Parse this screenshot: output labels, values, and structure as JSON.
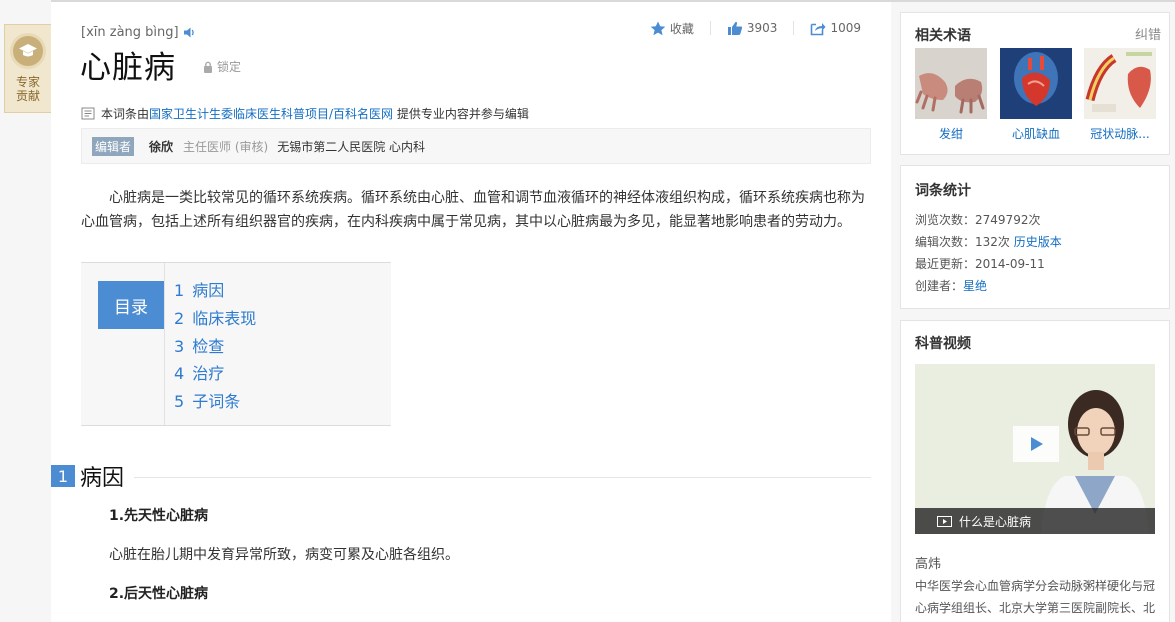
{
  "expert_badge": {
    "label": "专家贡献"
  },
  "entry": {
    "pinyin": "[xīn zàng bìng]",
    "title": "心脏病",
    "lock_label": "锁定"
  },
  "actions": {
    "favorite_label": "收藏",
    "like_count": "3903",
    "share_count": "1009"
  },
  "provider": {
    "prefix": "本词条由",
    "org_link": "国家卫生计生委临床医生科普项目/百科名医网",
    "suffix": "提供专业内容并参与编辑"
  },
  "editor": {
    "tag": "编辑者",
    "name": "徐欣",
    "role": "主任医师 (审核)",
    "organization": "无锡市第二人民医院 心内科"
  },
  "intro": "心脏病是一类比较常见的循环系统疾病。循环系统由心脏、血管和调节血液循环的神经体液组织构成，循环系统疾病也称为心血管病，包括上述所有组织器官的疾病，在内科疾病中属于常见病，其中以心脏病最为多见，能显著地影响患者的劳动力。",
  "toc": {
    "label": "目录",
    "items": [
      {
        "num": "1",
        "text": "病因"
      },
      {
        "num": "2",
        "text": "临床表现"
      },
      {
        "num": "3",
        "text": "检查"
      },
      {
        "num": "4",
        "text": "治疗"
      },
      {
        "num": "5",
        "text": "子词条"
      }
    ]
  },
  "section1": {
    "num": "1",
    "title": "病因",
    "sub1": "1.先天性心脏病",
    "para1": "心脏在胎儿期中发育异常所致，病变可累及心脏各组织。",
    "sub2": "2.后天性心脏病"
  },
  "related": {
    "title": "相关术语",
    "correction": "纠错",
    "terms": [
      {
        "label": "发绀"
      },
      {
        "label": "心肌缺血"
      },
      {
        "label": "冠状动脉..."
      }
    ]
  },
  "stats": {
    "title": "词条统计",
    "views_label": "浏览次数：",
    "views": "2749792次",
    "edits_label": "编辑次数：",
    "edits": "132次",
    "history_link": "历史版本",
    "updated_label": "最近更新：",
    "updated": "2014-09-11",
    "creator_label": "创建者：",
    "creator": "星绝"
  },
  "video": {
    "title": "科普视频",
    "caption": "什么是心脏病",
    "doctor_name": "高炜",
    "doctor_desc": "中华医学会心血管病学分会动脉粥样硬化与冠心病学组组长、北京大学第三医院副院长、北"
  },
  "colors": {
    "accent_blue": "#4c8cd3",
    "link_blue": "#136ec2",
    "badge_gold": "#c9b07a"
  }
}
